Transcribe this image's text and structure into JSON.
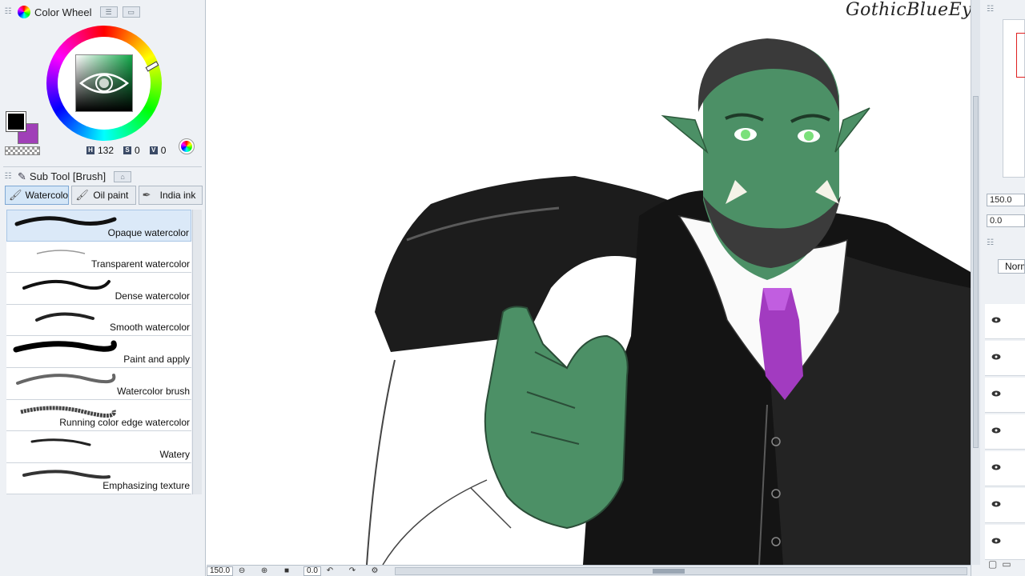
{
  "color_wheel": {
    "title": "Color Wheel",
    "hsv": {
      "h_label": "H",
      "h": "132",
      "s_label": "S",
      "s": "0",
      "v_label": "V",
      "v": "0"
    },
    "colors": {
      "main": "#000000",
      "sub": "#a040b8",
      "hue": "#13a84a"
    }
  },
  "sub_tool": {
    "title": "Sub Tool [Brush]",
    "tabs": [
      {
        "label": "Watercolor",
        "icon": "brush-icon"
      },
      {
        "label": "Oil paint",
        "icon": "brush-icon"
      },
      {
        "label": "India ink",
        "icon": "pen-icon"
      }
    ],
    "brushes": [
      {
        "label": "Opaque watercolor"
      },
      {
        "label": "Transparent watercolor"
      },
      {
        "label": "Dense watercolor"
      },
      {
        "label": "Smooth watercolor"
      },
      {
        "label": "Paint and apply"
      },
      {
        "label": "Watercolor brush"
      },
      {
        "label": "Running color edge watercolor"
      },
      {
        "label": "Watery"
      },
      {
        "label": "Emphasizing texture"
      }
    ]
  },
  "canvas": {
    "watermark": "GothicBlueEyes"
  },
  "statusbar": {
    "zoom": "150.0",
    "angle": "0.0"
  },
  "navigator": {
    "zoom": "150.0",
    "angle": "0.0"
  },
  "layer_panel": {
    "blend_mode": "Normal"
  }
}
